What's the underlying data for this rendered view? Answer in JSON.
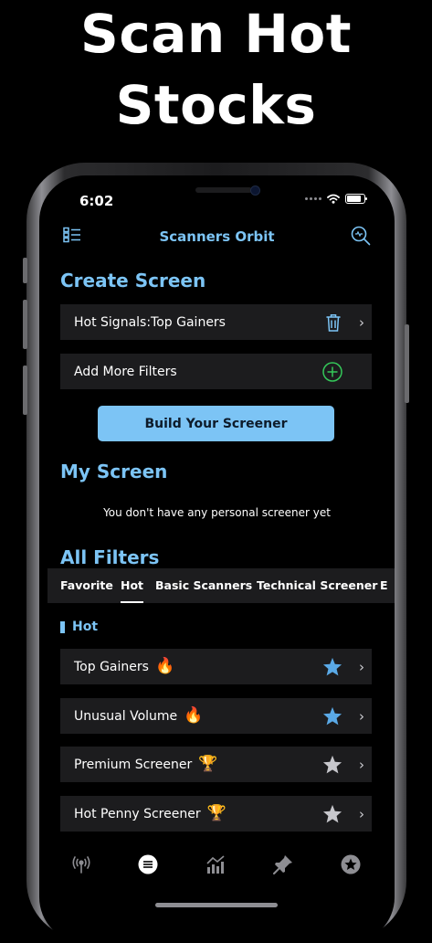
{
  "headline": {
    "line1": "Scan Hot",
    "line2": "Stocks"
  },
  "status_bar": {
    "time": "6:02"
  },
  "nav": {
    "title": "Scanners Orbit"
  },
  "create_screen": {
    "title": "Create Screen",
    "signal_row": "Hot Signals:Top Gainers",
    "add_filters_row": "Add More Filters",
    "build_button": "Build Your Screener"
  },
  "my_screen": {
    "title": "My Screen",
    "empty_message": "You don't have any personal screener yet"
  },
  "all_filters": {
    "title": "All Filters",
    "tabs": [
      "Favorite",
      "Hot",
      "Basic Scanners",
      "Technical Screener",
      "E"
    ],
    "active_tab": "Hot",
    "section_label": "Hot",
    "items": [
      {
        "label": "Top Gainers",
        "emoji": "🔥",
        "favorite": true
      },
      {
        "label": "Unusual Volume",
        "emoji": "🔥",
        "favorite": true
      },
      {
        "label": "Premium Screener",
        "emoji": "🏆",
        "favorite": false
      },
      {
        "label": "Hot Penny Screener",
        "emoji": "🏆",
        "favorite": false
      }
    ]
  },
  "tab_bar": {
    "items": [
      "signal-icon",
      "list-icon",
      "chart-icon",
      "pin-icon",
      "star-icon"
    ],
    "active_index": 1
  },
  "colors": {
    "accent": "#7cc4f5",
    "row_bg": "#1c1c1e",
    "star_active": "#5aa9e6",
    "star_inactive": "#c7c7cc",
    "add_icon": "#34c759"
  }
}
